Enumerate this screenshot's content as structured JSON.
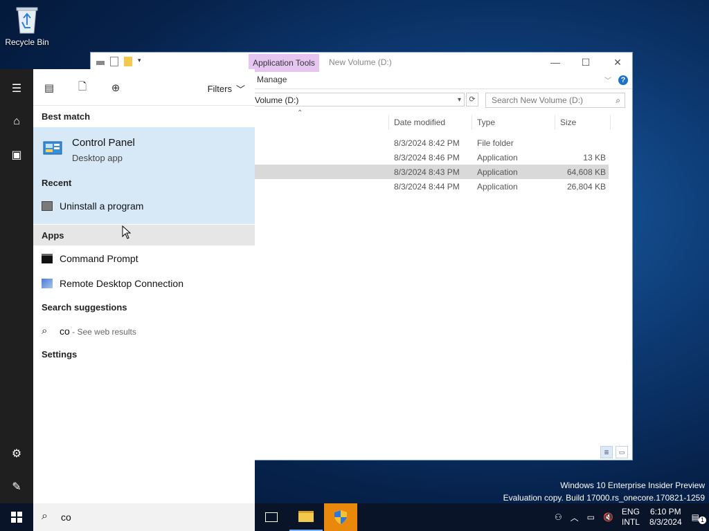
{
  "desktop": {
    "recycle_bin_label": "Recycle Bin",
    "watermark_line1": "Windows 10 Enterprise Insider Preview",
    "watermark_line2": "Evaluation copy. Build 17000.rs_onecore.170821-1259"
  },
  "explorer": {
    "title": "New Volume (D:)",
    "ribbon_context_tab": "Application Tools",
    "ribbon_manage_tab": "Manage",
    "address": "Volume (D:)",
    "search_placeholder": "Search New Volume (D:)",
    "columns": [
      "Date modified",
      "Type",
      "Size"
    ],
    "rows": [
      {
        "date": "8/3/2024 8:42 PM",
        "type": "File folder",
        "size": ""
      },
      {
        "date": "8/3/2024 8:46 PM",
        "type": "Application",
        "size": "13 KB"
      },
      {
        "date": "8/3/2024 8:43 PM",
        "type": "Application",
        "size": "64,608 KB"
      },
      {
        "date": "8/3/2024 8:44 PM",
        "type": "Application",
        "size": "26,804 KB"
      }
    ]
  },
  "start": {
    "filters_label": "Filters",
    "best_match_header": "Best match",
    "best_match_title": "Control Panel",
    "best_match_subtitle": "Desktop app",
    "recent_header": "Recent",
    "recent_item": "Uninstall a program",
    "apps_header": "Apps",
    "apps": [
      "Command Prompt",
      "Remote Desktop Connection"
    ],
    "suggestions_header": "Search suggestions",
    "suggestion_query": "co",
    "suggestion_suffix": " - See web results",
    "settings_header": "Settings",
    "search_query": "co"
  },
  "taskbar": {
    "lang_top": "ENG",
    "lang_bottom": "INTL",
    "time": "6:10 PM",
    "date": "8/3/2024",
    "notification_count": "1"
  },
  "colors": {
    "accent_orange": "#e8890c",
    "best_match_bg": "#d7e9f6",
    "app_tools_tab": "#e6c6f0"
  }
}
